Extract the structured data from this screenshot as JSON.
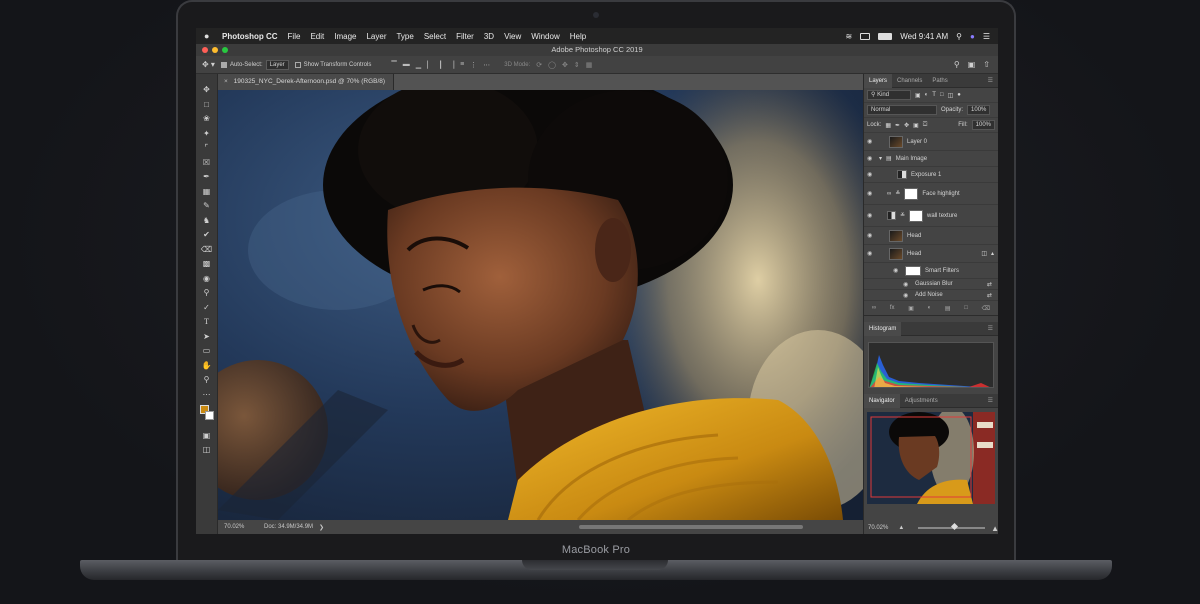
{
  "device": {
    "brand_label": "MacBook Pro"
  },
  "menubar": {
    "app_name": "Photoshop CC",
    "items": [
      "File",
      "Edit",
      "Image",
      "Layer",
      "Type",
      "Select",
      "Filter",
      "3D",
      "View",
      "Window",
      "Help"
    ],
    "clock": "Wed 9:41 AM"
  },
  "window": {
    "title": "Adobe Photoshop CC 2019"
  },
  "options_bar": {
    "auto_select_label": "Auto-Select:",
    "auto_select_value": "Layer",
    "transform_label": "Show Transform Controls",
    "mode_3d_label": "3D Mode:"
  },
  "document": {
    "tab_title": "190325_NYC_Derek-Afternoon.psd @ 70% (RGB/8)",
    "zoom": "70.02%",
    "doc_size": "Doc: 34.9M/34.9M"
  },
  "layers_panel": {
    "tabs": [
      "Layers",
      "Channels",
      "Paths"
    ],
    "kind_filter": "Kind",
    "blend_mode": "Normal",
    "opacity_label": "Opacity:",
    "opacity_value": "100%",
    "lock_label": "Lock:",
    "fill_label": "Fill:",
    "fill_value": "100%",
    "layers": [
      {
        "name": "Layer 0"
      },
      {
        "name": "Main Image"
      },
      {
        "name": "Exposure 1"
      },
      {
        "name": "Face highlight"
      },
      {
        "name": "wall texture"
      },
      {
        "name": "Head"
      },
      {
        "name": "Head"
      },
      {
        "name": "Smart Filters"
      },
      {
        "name": "Gaussian Blur"
      },
      {
        "name": "Add Noise"
      }
    ]
  },
  "histogram_panel": {
    "title": "Histogram"
  },
  "navigator_panel": {
    "tabs": [
      "Navigator",
      "Adjustments"
    ],
    "zoom": "70.02%"
  },
  "colors": {
    "foreground": "#c98a12",
    "background": "#ffffff"
  }
}
